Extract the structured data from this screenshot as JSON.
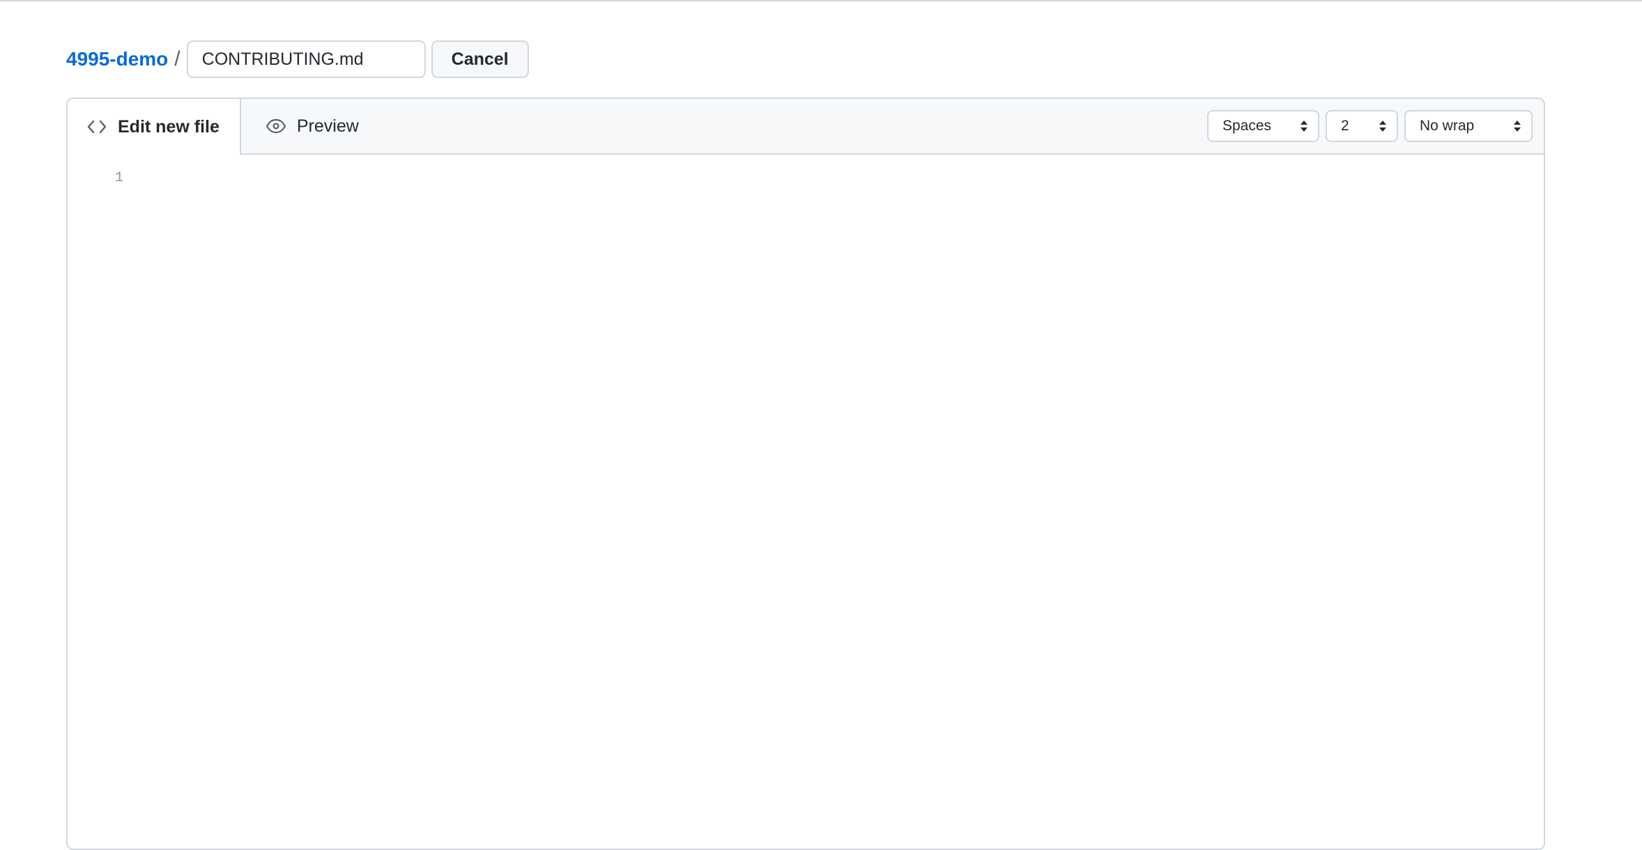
{
  "breadcrumb": {
    "repo": "4995-demo",
    "separator": "/"
  },
  "filename": {
    "value": "CONTRIBUTING.md",
    "placeholder": "Name your file..."
  },
  "actions": {
    "cancel_label": "Cancel"
  },
  "editor": {
    "tabs": [
      {
        "label": "Edit new file",
        "icon": "code-icon",
        "active": true
      },
      {
        "label": "Preview",
        "icon": "eye-icon",
        "active": false
      }
    ],
    "options": {
      "indent_mode": "Spaces",
      "indent_size": "2",
      "wrap_mode": "No wrap"
    },
    "lines": [
      {
        "number": "1",
        "content": ""
      }
    ]
  },
  "colors": {
    "link": "#0969da",
    "border": "#d0d7de",
    "header_bg": "#f6f8fa",
    "line_number": "#8c959f"
  }
}
